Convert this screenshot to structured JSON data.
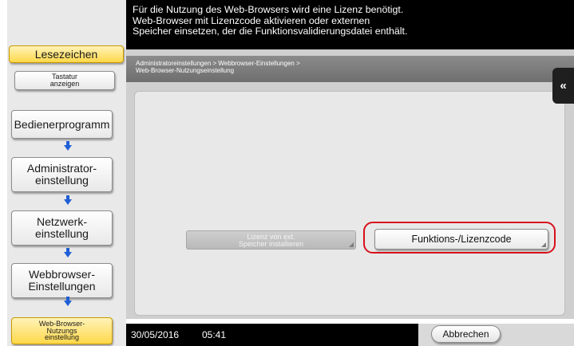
{
  "message": {
    "line1": "Für die Nutzung des Web-Browsers wird eine Lizenz benötigt.",
    "line2": "Web-Browser mit Lizenzcode aktivieren oder externen",
    "line3": "Speicher einsetzen, der die Funktionsvalidierungsdatei enthält."
  },
  "sidebar": {
    "bookmark_label": "Lesezeichen",
    "keyboard_line1": "Tastatur",
    "keyboard_line2": "anzeigen",
    "items": [
      {
        "line1": "Bedienerprogramm",
        "line2": ""
      },
      {
        "line1": "Administrator-",
        "line2": "einstellung"
      },
      {
        "line1": "Netzwerk-",
        "line2": "einstellung"
      },
      {
        "line1": "Webbrowser-",
        "line2": "Einstellungen"
      }
    ],
    "current": {
      "line1": "Web-Browser-",
      "line2": "Nutzungs",
      "line3": "einstellung"
    },
    "arrow_color": "#1f5fd6"
  },
  "breadcrumb": {
    "line1": "Administratoreinstellungen > Webbrowser-Einstellungen >",
    "line2": "Web-Browser-Nutzungseinstellung"
  },
  "buttons": {
    "external_line1": "Lizenz von ext.",
    "external_line2": "Speicher installieren",
    "license_code": "Funktions-/Lizenzcode",
    "cancel": "Abbrechen",
    "collapse_icon": "«"
  },
  "status": {
    "date": "30/05/2016",
    "time": "05:41"
  },
  "colors": {
    "highlight": "#d7111c",
    "bookmark_yellow": "#ffd84a"
  }
}
